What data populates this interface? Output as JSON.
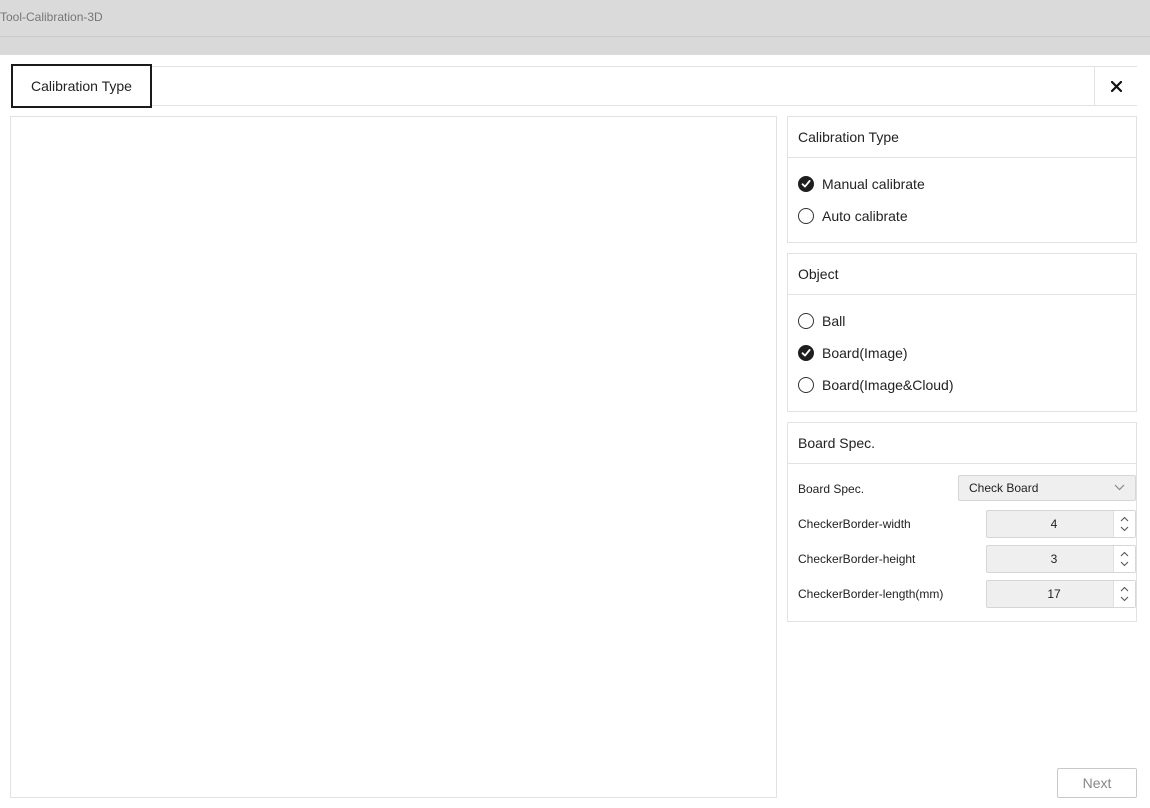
{
  "window": {
    "title": "Tool-Calibration-3D"
  },
  "tabs": [
    {
      "label": "Calibration Type",
      "active": true
    }
  ],
  "calibration_type": {
    "header": "Calibration Type",
    "options": [
      {
        "label": "Manual calibrate",
        "checked": true
      },
      {
        "label": "Auto calibrate",
        "checked": false
      }
    ]
  },
  "object": {
    "header": "Object",
    "options": [
      {
        "label": "Ball",
        "checked": false
      },
      {
        "label": "Board(Image)",
        "checked": true
      },
      {
        "label": "Board(Image&Cloud)",
        "checked": false
      }
    ]
  },
  "board_spec": {
    "header": "Board Spec.",
    "spec_label": "Board Spec.",
    "spec_value": "Check Board",
    "width_label": "CheckerBorder-width",
    "width_value": "4",
    "height_label": "CheckerBorder-height",
    "height_value": "3",
    "length_label": "CheckerBorder-length(mm)",
    "length_value": "17"
  },
  "footer": {
    "next_label": "Next"
  },
  "icons": {
    "close": "close-icon",
    "radio_check": "check-icon",
    "dropdown": "chevron-down-icon",
    "spin_up": "chevron-up-icon",
    "spin_down": "chevron-down-icon"
  },
  "colors": {
    "titlebar": "#dadada",
    "border": "#e2e2e2",
    "active_tab_border": "#1a1a1a",
    "field_bg": "#efefef",
    "disabled_text": "#888888"
  }
}
